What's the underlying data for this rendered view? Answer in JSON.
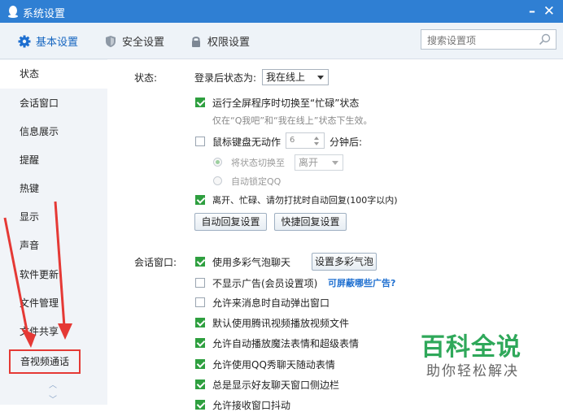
{
  "window": {
    "title": "系统设置",
    "minimize": "–",
    "close": "✕"
  },
  "tabs": [
    {
      "label": "基本设置",
      "icon": "gear-icon",
      "active": true
    },
    {
      "label": "安全设置",
      "icon": "shield-icon"
    },
    {
      "label": "权限设置",
      "icon": "lock-icon"
    }
  ],
  "search": {
    "placeholder": "搜索设置项"
  },
  "sidebar": {
    "items": [
      "状态",
      "会话窗口",
      "信息展示",
      "提醒",
      "热键",
      "显示",
      "声音",
      "软件更新",
      "文件管理",
      "文件共享",
      "音视频通话"
    ],
    "active_index": 0,
    "highlighted_index": 10,
    "scroll_up": "︿",
    "scroll_down": "﹀"
  },
  "status_section": {
    "label": "状态:",
    "login_status_label": "登录后状态为:",
    "login_status_value": "我在线上",
    "fullscreen_busy": {
      "label": "运行全屏程序时切换至“忙碌”状态",
      "checked": true
    },
    "fullscreen_hint": "仅在“Q我吧”和“我在线上”状态下生效。",
    "idle": {
      "label": "鼠标键盘无动作",
      "checked": false,
      "minutes": "6",
      "suffix": "分钟后:"
    },
    "switch_status": {
      "label": "将状态切换至",
      "value": "离开",
      "selected": true
    },
    "auto_lock": {
      "label": "自动锁定QQ",
      "selected": false
    },
    "auto_reply": {
      "label": "离开、忙碌、请勿打扰时自动回复(100字以内)",
      "checked": true
    },
    "buttons": {
      "auto_reply": "自动回复设置",
      "quick_reply": "快捷回复设置"
    }
  },
  "chat_section": {
    "label": "会话窗口:",
    "items": [
      {
        "label": "使用多彩气泡聊天",
        "checked": true
      },
      {
        "label": "不显示广告(会员设置项)",
        "checked": false
      },
      {
        "label": "允许来消息时自动弹出窗口",
        "checked": false
      },
      {
        "label": "默认使用腾讯视频播放视频文件",
        "checked": true
      },
      {
        "label": "允许自动播放魔法表情和超级表情",
        "checked": true
      },
      {
        "label": "允许使用QQ秀聊天随动表情",
        "checked": true
      },
      {
        "label": "总是显示好友聊天窗口侧边栏",
        "checked": true
      },
      {
        "label": "允许接收窗口抖动",
        "checked": true
      }
    ],
    "bubble_button": "设置多彩气泡",
    "ads_link": "可屏蔽哪些广告?"
  },
  "watermark": {
    "title": "百科全说",
    "subtitle": "助你轻松解决"
  },
  "colors": {
    "titlebar": "#2f7fd3",
    "check": "#2e9f3f",
    "annotation": "#e53935",
    "watermark": "#2fa85a"
  }
}
